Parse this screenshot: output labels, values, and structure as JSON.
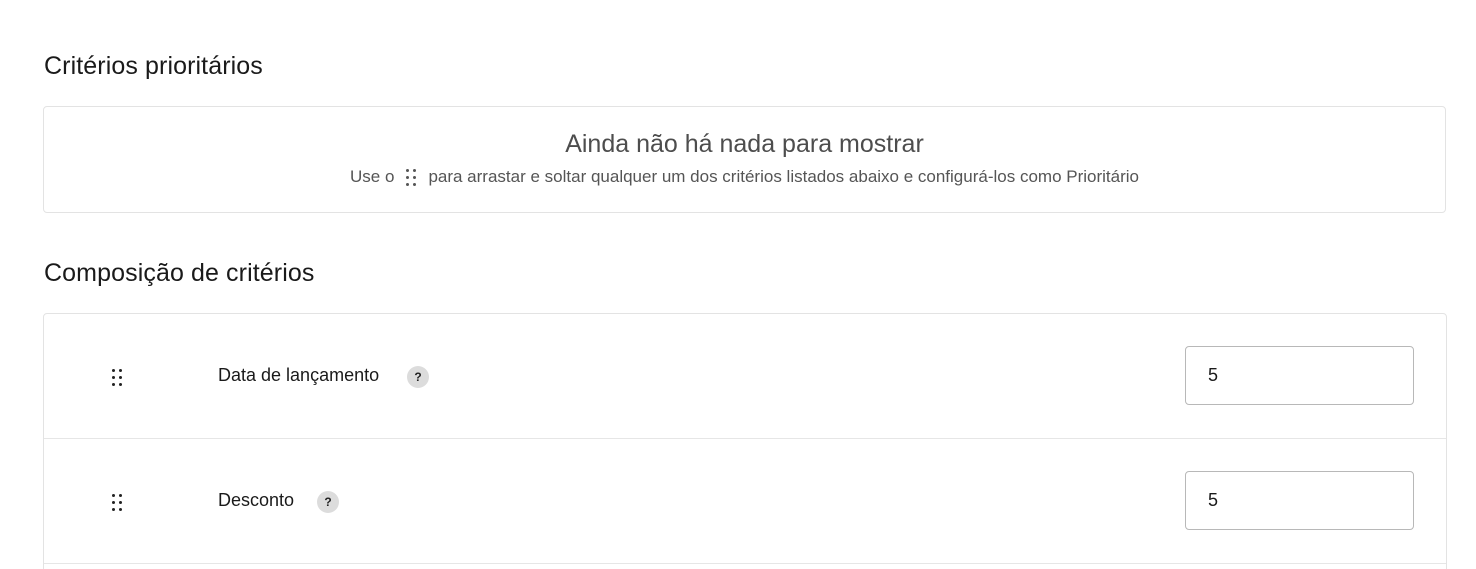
{
  "priority_section": {
    "title": "Critérios prioritários",
    "empty_title": "Ainda não há nada para mostrar",
    "empty_desc_prefix": "Use o",
    "empty_desc_icon": "drag-handle-icon",
    "empty_desc_suffix": "para arrastar e soltar qualquer um dos critérios listados abaixo e configurá-los como Prioritário"
  },
  "composition_section": {
    "title": "Composição de critérios",
    "criteria": [
      {
        "label": "Data de lançamento",
        "help_label": "?",
        "value": "5"
      },
      {
        "label": "Desconto",
        "help_label": "?",
        "value": "5"
      }
    ]
  }
}
